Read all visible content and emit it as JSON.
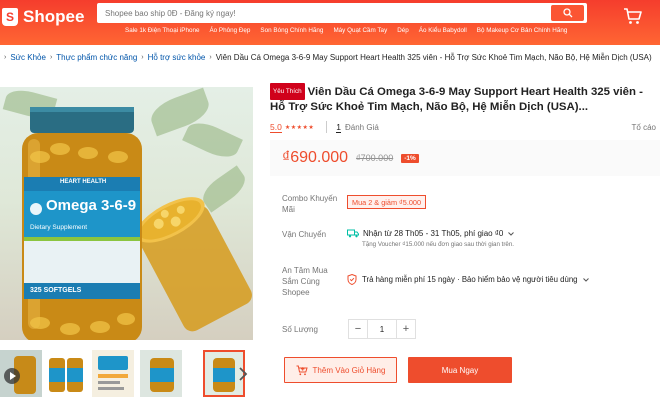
{
  "header": {
    "logo_text": "Shopee",
    "search_placeholder": "Shopee bao ship 0Đ - Đăng ký ngay!",
    "hints": [
      "Sale 1k Điện Thoại iPhone",
      "Áo Phông Đẹp",
      "Son Bóng Chính Hãng",
      "Máy Quạt Cầm Tay",
      "Dép",
      "Áo Kiểu Babydoll",
      "Bộ Makeup Cơ Bản Chính Hãng"
    ]
  },
  "breadcrumb": {
    "items": [
      "Sức Khỏe",
      "Thực phẩm chức năng",
      "Hỗ trợ sức khỏe"
    ],
    "current": "Viên Dầu Cá Omega 3-6-9 May Support Heart Health 325 viên - Hỗ Trợ Sức Khoẻ Tim Mạch, Não Bộ, Hệ Miễn Dịch (USA)"
  },
  "gallery": {
    "bottle_label": {
      "brand": "HEART HEALTH",
      "product": "Omega 3-6-9",
      "sub": "Dietary Supplement",
      "count": "325 SOFTGELS"
    }
  },
  "product": {
    "tag": "Yêu Thích",
    "title": "Viên Dầu Cá Omega 3-6-9 May Support Heart Health 325 viên - Hỗ Trợ Sức Khoẻ Tim Mạch, Não Bộ, Hệ Miễn Dịch (USA)...",
    "rating": "5.0",
    "stars": 5,
    "review_count": "1",
    "review_label": "Đánh Giá",
    "report": "Tố cáo",
    "price": "₫690.000",
    "original_price": "₫700.000",
    "discount": "-1%",
    "combo_label": "Combo Khuyến Mãi",
    "combo_value": "Mua 2 & giảm ₫5.000",
    "shipping_label": "Vận Chuyển",
    "shipping_value": "Nhận từ 28 Th05 - 31 Th05, phí giao ₫0",
    "shipping_note": "Tặng Voucher ₫15.000 nếu đơn giao sau thời gian trên.",
    "assurance_label": "An Tâm Mua Sắm Cùng Shopee",
    "assurance_value": "Trả hàng miễn phí 15 ngày · Bảo hiểm bảo vệ người tiêu dùng",
    "quantity_label": "Số Lượng",
    "quantity": "1",
    "add_to_cart": "Thêm Vào Giỏ Hàng",
    "buy_now": "Mua Ngay"
  },
  "colors": {
    "brand": "#ee4d2d",
    "header_gradient_start": "#f53d2d",
    "header_gradient_end": "#ff6633"
  }
}
